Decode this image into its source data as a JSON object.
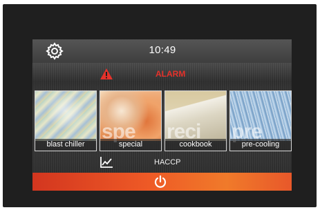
{
  "topbar": {
    "time": "10:49",
    "settings_icon": "gear-icon"
  },
  "alarm": {
    "label": "ALARM",
    "icon": "warning-triangle-icon",
    "color": "#e5322b"
  },
  "tiles": [
    {
      "label": "blast chiller",
      "watermark": ""
    },
    {
      "label": "special",
      "watermark": "spe"
    },
    {
      "label": "cookbook",
      "watermark": "reci"
    },
    {
      "label": "pre-cooling",
      "watermark": "pre"
    }
  ],
  "haccp": {
    "label": "HACCP",
    "icon": "chart-line-icon"
  },
  "power": {
    "icon": "power-icon",
    "color": "#ee5a26"
  }
}
